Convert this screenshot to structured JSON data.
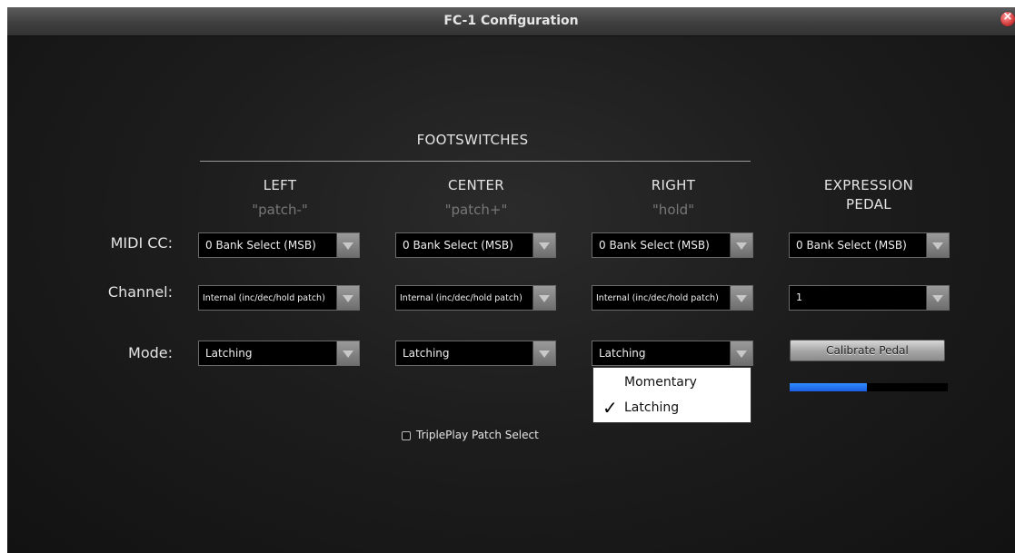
{
  "window": {
    "title": "FC-1 Configuration"
  },
  "headers": {
    "footswitches": "FOOTSWITCHES",
    "left": "LEFT",
    "left_sub": "\"patch-\"",
    "center": "CENTER",
    "center_sub": "\"patch+\"",
    "right": "RIGHT",
    "right_sub": "\"hold\"",
    "expression_line1": "EXPRESSION",
    "expression_line2": "PEDAL"
  },
  "row_labels": {
    "midi_cc": "MIDI CC:",
    "channel": "Channel:",
    "mode": "Mode:"
  },
  "midi_cc": {
    "left": "0 Bank Select (MSB)",
    "center": "0 Bank Select (MSB)",
    "right": "0 Bank Select (MSB)",
    "expression": "0 Bank Select (MSB)"
  },
  "channel": {
    "left": "Internal (inc/dec/hold patch)",
    "center": "Internal (inc/dec/hold patch)",
    "right": "Internal (inc/dec/hold patch)",
    "expression": "1"
  },
  "mode": {
    "left": "Latching",
    "center": "Latching",
    "right": "Latching"
  },
  "mode_dropdown": {
    "options": [
      {
        "label": "Momentary",
        "selected": false
      },
      {
        "label": "Latching",
        "selected": true
      }
    ]
  },
  "calibrate": {
    "label": "Calibrate Pedal"
  },
  "pedal_level": {
    "fraction": 0.49,
    "color": "#2a79f5"
  },
  "tripleplay": {
    "label": "TriplePlay Patch Select",
    "checked": false
  }
}
